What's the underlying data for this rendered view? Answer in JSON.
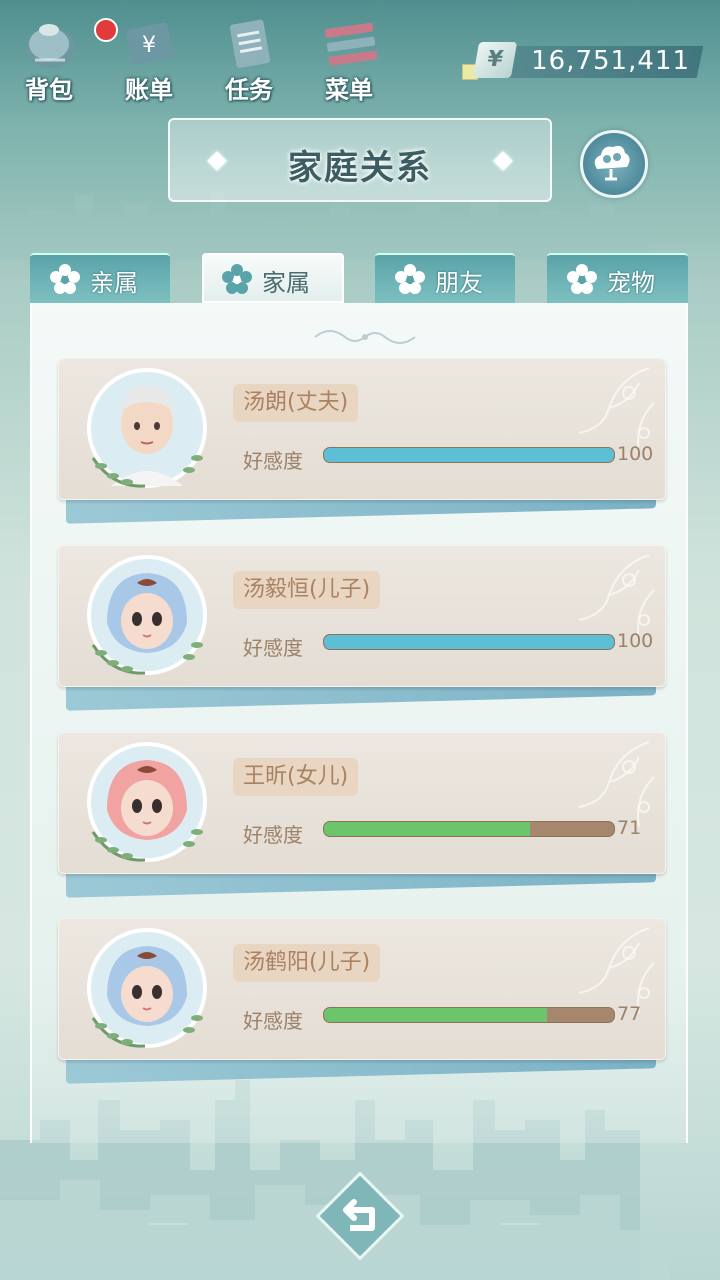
{
  "nav": {
    "bag_label": "背包",
    "bill_label": "账单",
    "task_label": "任务",
    "menu_label": "菜单",
    "bag_has_notification": true
  },
  "currency": {
    "symbol": "¥",
    "amount": "16,751,411"
  },
  "title": "家庭关系",
  "tabs": [
    {
      "label": "亲属",
      "active": false
    },
    {
      "label": "家属",
      "active": true
    },
    {
      "label": "朋友",
      "active": false
    },
    {
      "label": "宠物",
      "active": false
    }
  ],
  "affinity_label": "好感度",
  "members": [
    {
      "name": "汤朗(丈夫)",
      "affinity": 100,
      "affinity_text": "100",
      "bar_color": "#5cbfd6",
      "avatar": "adult-man-white-hair"
    },
    {
      "name": "汤毅恒(儿子)",
      "affinity": 100,
      "affinity_text": "100",
      "bar_color": "#5cbfd6",
      "avatar": "baby-blue-hood"
    },
    {
      "name": "王昕(女儿)",
      "affinity": 71,
      "affinity_text": "71",
      "bar_color": "#6cc56a",
      "avatar": "baby-pink-hood"
    },
    {
      "name": "汤鹤阳(儿子)",
      "affinity": 77,
      "affinity_text": "77",
      "bar_color": "#6cc56a",
      "avatar": "baby-blue-hood"
    }
  ],
  "colors": {
    "accent_teal": "#5aa3a8",
    "full_affinity": "#5cbfd6",
    "partial_affinity": "#6cc56a",
    "bar_track": "#a6866c"
  }
}
